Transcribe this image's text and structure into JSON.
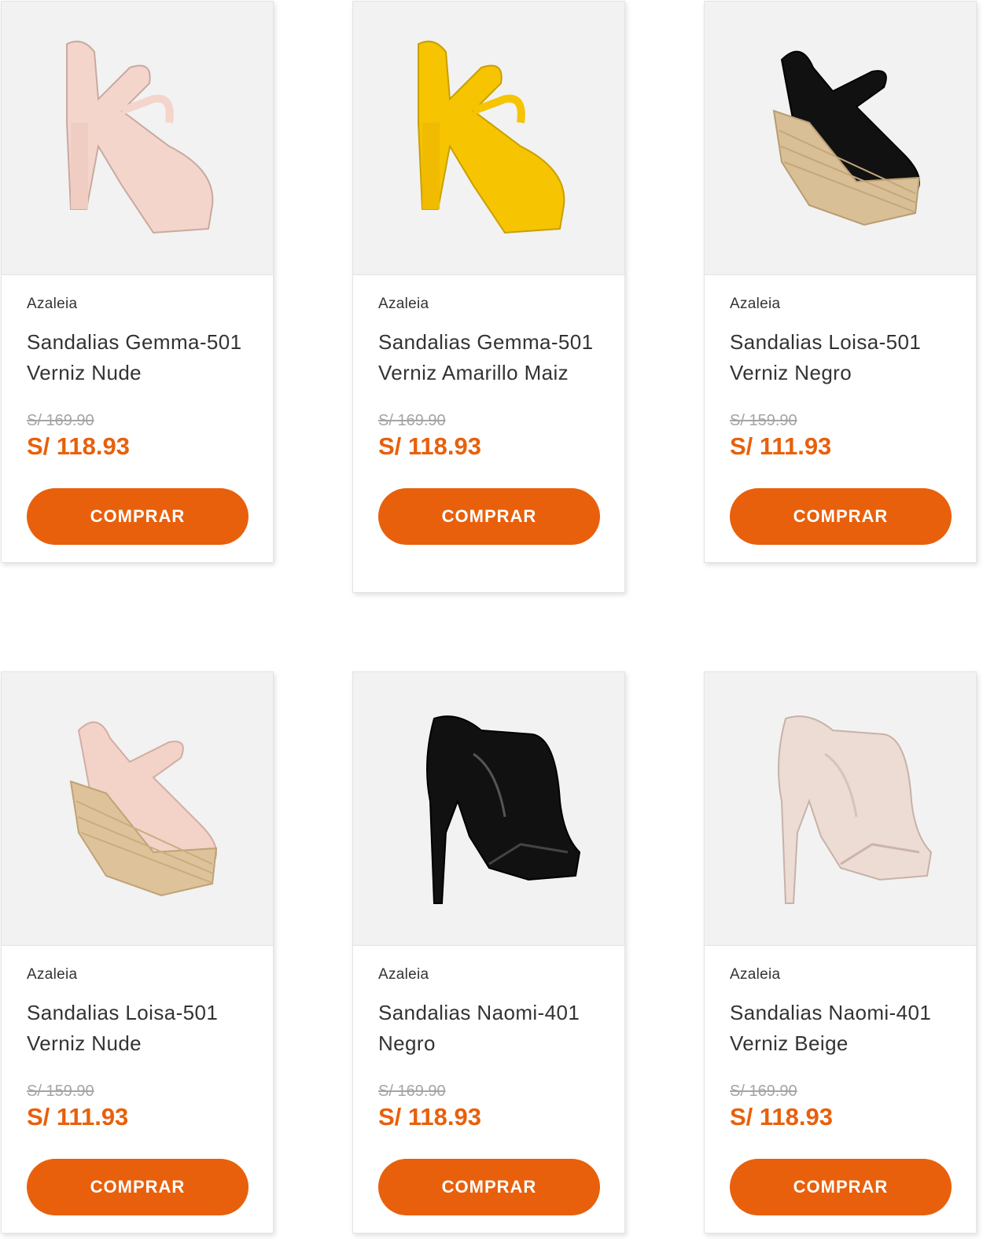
{
  "accent_color": "#e8600c",
  "products": [
    {
      "brand": "Azaleia",
      "name": "Sandalias Gemma-501 Verniz Nude",
      "old_price": "S/ 169.90",
      "price": "S/ 118.93",
      "button": "COMPRAR",
      "image_icon": "heeled-sandal-icon",
      "shoe_color": "#f3d5cc"
    },
    {
      "brand": "Azaleia",
      "name": "Sandalias Gemma-501 Verniz Amarillo Maiz",
      "old_price": "S/ 169.90",
      "price": "S/ 118.93",
      "button": "COMPRAR",
      "image_icon": "heeled-sandal-icon",
      "shoe_color": "#f6c400"
    },
    {
      "brand": "Azaleia",
      "name": "Sandalias Loisa-501 Verniz Negro",
      "old_price": "S/ 159.90",
      "price": "S/ 111.93",
      "button": "COMPRAR",
      "image_icon": "wedge-sandal-icon",
      "shoe_color": "#111111"
    },
    {
      "brand": "Azaleia",
      "name": "Sandalias Loisa-501 Verniz Nude",
      "old_price": "S/ 159.90",
      "price": "S/ 111.93",
      "button": "COMPRAR",
      "image_icon": "wedge-sandal-icon",
      "shoe_color": "#f3d2c8"
    },
    {
      "brand": "Azaleia",
      "name": "Sandalias Naomi-401 Negro",
      "old_price": "S/ 169.90",
      "price": "S/ 118.93",
      "button": "COMPRAR",
      "image_icon": "mule-heel-icon",
      "shoe_color": "#111111"
    },
    {
      "brand": "Azaleia",
      "name": "Sandalias Naomi-401 Verniz Beige",
      "old_price": "S/ 169.90",
      "price": "S/ 118.93",
      "button": "COMPRAR",
      "image_icon": "mule-heel-icon",
      "shoe_color": "#eddcd4"
    }
  ]
}
